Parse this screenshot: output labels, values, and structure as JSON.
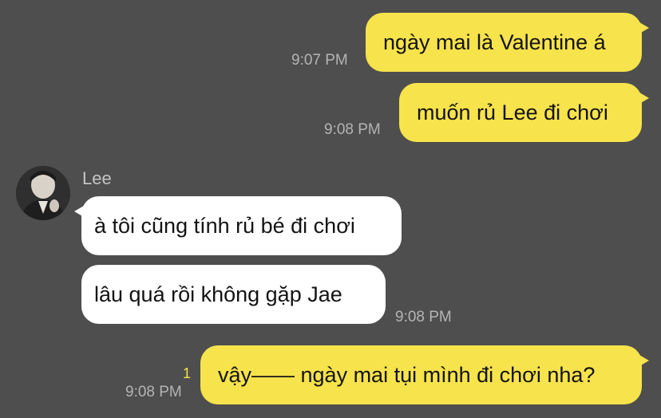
{
  "chat": {
    "messages": [
      {
        "sender": "me",
        "text": "ngày mai là Valentine á",
        "time": "9:07 PM"
      },
      {
        "sender": "me",
        "text": "muốn rủ Lee đi chơi",
        "time": "9:08 PM"
      },
      {
        "sender": "Lee",
        "text": "à tôi cũng tính rủ bé đi chơi"
      },
      {
        "sender": "Lee",
        "text": "lâu quá rồi không gặp Jae",
        "time": "9:08 PM"
      },
      {
        "sender": "me",
        "text": "vậy—— ngày mai tụi mình đi chơi nha?",
        "time": "9:08 PM",
        "unread_count": "1"
      }
    ],
    "contact": {
      "name": "Lee",
      "avatar_icon": "profile-photo"
    }
  },
  "colors": {
    "background": "#4e4e4e",
    "my_bubble": "#f7e34b",
    "their_bubble": "#ffffff",
    "timestamp": "#b4b4b4",
    "unread_badge": "#f7e34b"
  }
}
